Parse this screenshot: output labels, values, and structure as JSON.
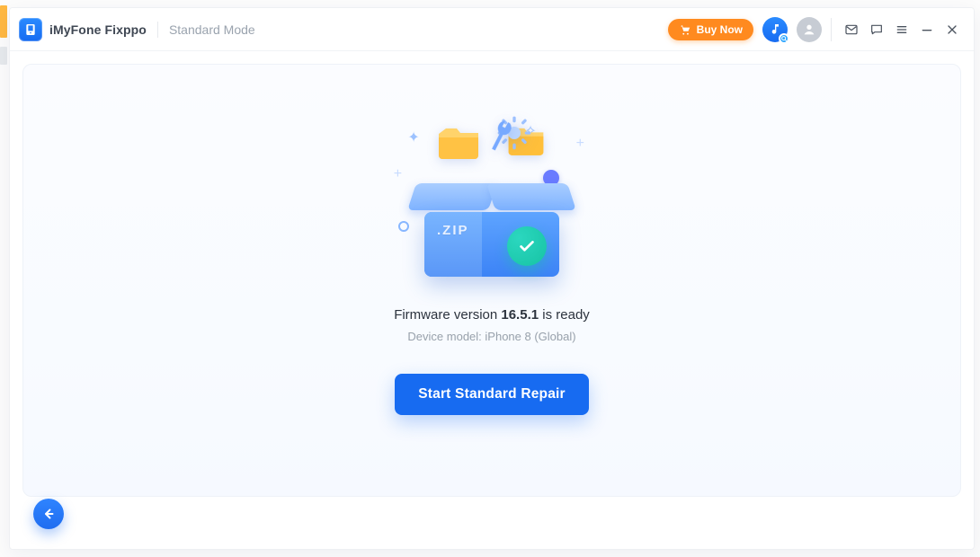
{
  "app": {
    "name": "iMyFone Fixppo",
    "mode": "Standard Mode"
  },
  "titlebar": {
    "buy_label": "Buy Now"
  },
  "main": {
    "zip_label": ".ZIP",
    "firmware_line_prefix": "Firmware version ",
    "firmware_version": "16.5.1",
    "firmware_line_suffix": " is ready",
    "device_label": "Device model: ",
    "device_value": "iPhone 8 (Global)",
    "cta_label": "Start Standard Repair"
  }
}
